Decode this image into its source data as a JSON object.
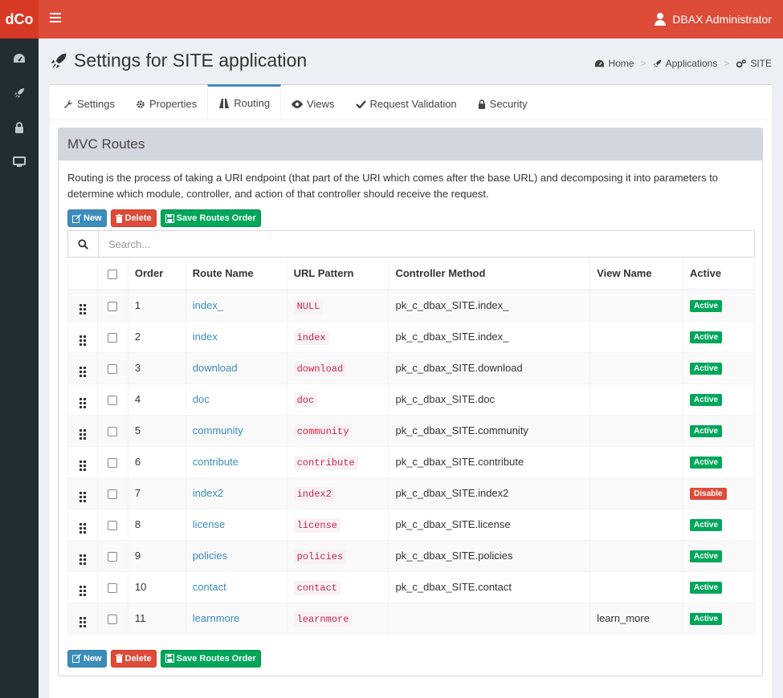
{
  "app": {
    "logo": "dCo",
    "user": "DBAX Administrator"
  },
  "page": {
    "title": "Settings for SITE application"
  },
  "breadcrumb": [
    "Home",
    "Applications",
    "SITE"
  ],
  "tabs": [
    "Settings",
    "Properties",
    "Routing",
    "Views",
    "Request Validation",
    "Security"
  ],
  "panel": {
    "title": "MVC Routes",
    "intro": "Routing is the process of taking a URI endpoint (that part of the URI which comes after the base URL) and decomposing it into parameters to determine which module, controller, and action of that controller should receive the request."
  },
  "buttons": {
    "new": "New",
    "delete": "Delete",
    "save_order": "Save Routes Order"
  },
  "search": {
    "placeholder": "Search..."
  },
  "table": {
    "headers": [
      "Order",
      "Route Name",
      "URL Pattern",
      "Controller Method",
      "View Name",
      "Active"
    ],
    "rows": [
      {
        "order": "1",
        "name": "index_",
        "url": "NULL",
        "method": "pk_c_dbax_SITE.index_",
        "view": "",
        "status": "Active"
      },
      {
        "order": "2",
        "name": "index",
        "url": "index",
        "method": "pk_c_dbax_SITE.index_",
        "view": "",
        "status": "Active"
      },
      {
        "order": "3",
        "name": "download",
        "url": "download",
        "method": "pk_c_dbax_SITE.download",
        "view": "",
        "status": "Active"
      },
      {
        "order": "4",
        "name": "doc",
        "url": "doc",
        "method": "pk_c_dbax_SITE.doc",
        "view": "",
        "status": "Active"
      },
      {
        "order": "5",
        "name": "community",
        "url": "community",
        "method": "pk_c_dbax_SITE.community",
        "view": "",
        "status": "Active"
      },
      {
        "order": "6",
        "name": "contribute",
        "url": "contribute",
        "method": "pk_c_dbax_SITE.contribute",
        "view": "",
        "status": "Active"
      },
      {
        "order": "7",
        "name": "index2",
        "url": "index2",
        "method": "pk_c_dbax_SITE.index2",
        "view": "",
        "status": "Disable"
      },
      {
        "order": "8",
        "name": "license",
        "url": "license",
        "method": "pk_c_dbax_SITE.license",
        "view": "",
        "status": "Active"
      },
      {
        "order": "9",
        "name": "policies",
        "url": "policies",
        "method": "pk_c_dbax_SITE.policies",
        "view": "",
        "status": "Active"
      },
      {
        "order": "10",
        "name": "contact",
        "url": "contact",
        "method": "pk_c_dbax_SITE.contact",
        "view": "",
        "status": "Active"
      },
      {
        "order": "11",
        "name": "learnmore",
        "url": "learnmore",
        "method": "",
        "view": "learn_more",
        "status": "Active"
      }
    ]
  },
  "colors": {
    "header": "#dd4b39",
    "sidebar": "#222d32",
    "primary": "#3c8dbc",
    "success": "#00a65a",
    "danger": "#dd4b39"
  }
}
